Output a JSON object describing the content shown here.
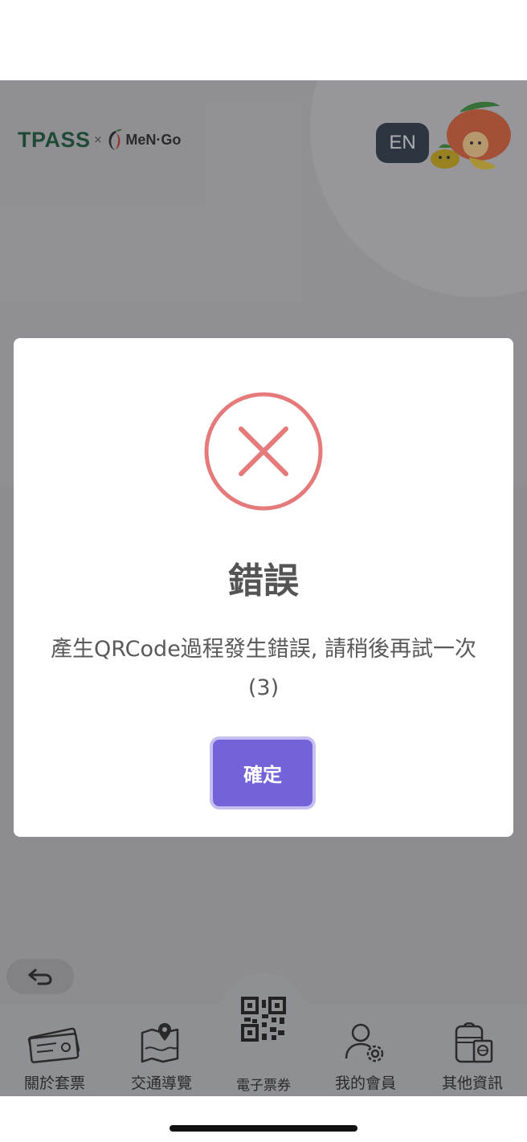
{
  "header": {
    "logo_brand": "TPASS",
    "logo_separator": "×",
    "logo_partner": "MeN·Go",
    "language_button": "EN"
  },
  "tabbar": {
    "items": [
      {
        "label": "關於套票",
        "icon": "tickets-icon"
      },
      {
        "label": "交通導覽",
        "icon": "map-pin-icon"
      },
      {
        "label": "電子票券",
        "icon": "qr-code-icon"
      },
      {
        "label": "我的會員",
        "icon": "user-settings-icon"
      },
      {
        "label": "其他資訊",
        "icon": "luggage-passport-icon"
      }
    ]
  },
  "back_button": {
    "icon": "back-arrow-icon"
  },
  "modal": {
    "icon": "error-x-icon",
    "title": "錯誤",
    "message": "產生QRCode過程發生錯誤, 請稍後再試一次(3)",
    "confirm_label": "確定"
  },
  "colors": {
    "accent": "#7363d9",
    "error": "#e57a7a",
    "logo_green": "#1d5a3a",
    "lang_button_bg": "#2f3b48"
  }
}
